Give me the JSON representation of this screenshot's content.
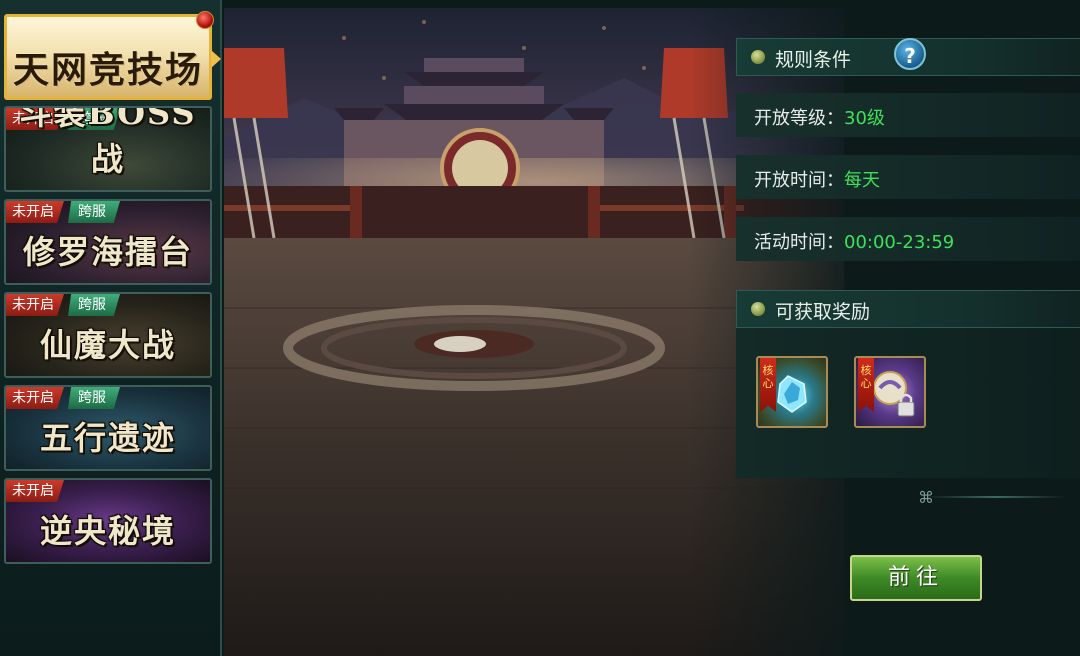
{
  "sidebar": {
    "tabs": [
      {
        "title": "天网竞技场",
        "status": "",
        "cross": ""
      },
      {
        "title": "斗装BOSS战",
        "status": "未开启",
        "cross": "跨服"
      },
      {
        "title": "修罗海擂台",
        "status": "未开启",
        "cross": "跨服"
      },
      {
        "title": "仙魔大战",
        "status": "未开启",
        "cross": "跨服"
      },
      {
        "title": "五行遗迹",
        "status": "未开启",
        "cross": "跨服"
      },
      {
        "title": "逆央秘境",
        "status": "未开启",
        "cross": ""
      }
    ]
  },
  "rules": {
    "header": "规则条件",
    "help": "?",
    "level_label": "开放等级：",
    "level_value": "30级",
    "time_label": "开放时间：",
    "time_value": "每天",
    "activity_label": "活动时间：",
    "activity_value": "00:00-23:59"
  },
  "rewards": {
    "header": "可获取奖励",
    "items": [
      {
        "tag": "核心",
        "icon": "blue-crystal-icon"
      },
      {
        "tag": "核心",
        "icon": "locked-orb-icon"
      }
    ]
  },
  "divider_glyph": "⌘",
  "goto_label": "前往",
  "colors": {
    "accent_gold": "#e6b238",
    "value_green": "#3ee05a",
    "badge_red": "#cc3a2a",
    "badge_green": "#3fae7a"
  }
}
